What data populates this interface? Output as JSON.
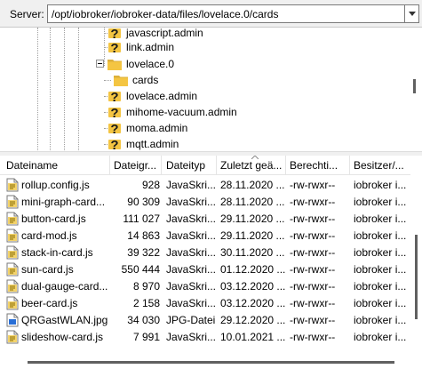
{
  "server": {
    "label": "Server:",
    "path": "/opt/iobroker/iobroker-data/files/lovelace.0/cards"
  },
  "tree": {
    "items": [
      {
        "label": "javascript.admin",
        "icon": "question-folder-icon"
      },
      {
        "label": "link.admin",
        "icon": "question-folder-icon"
      },
      {
        "label": "lovelace.0",
        "icon": "folder-icon",
        "expanded": true
      },
      {
        "label": "cards",
        "icon": "folder-icon",
        "selected": true
      },
      {
        "label": "lovelace.admin",
        "icon": "question-folder-icon"
      },
      {
        "label": "mihome-vacuum.admin",
        "icon": "question-folder-icon"
      },
      {
        "label": "moma.admin",
        "icon": "question-folder-icon"
      },
      {
        "label": "mqtt.admin",
        "icon": "question-folder-icon"
      }
    ]
  },
  "list": {
    "columns": [
      "Dateiname",
      "Dateigr...",
      "Dateityp",
      "Zuletzt geä...",
      "Berechti...",
      "Besitzer/..."
    ],
    "rows": [
      {
        "name": "rollup.config.js",
        "size": "928",
        "type": "JavaSkri...",
        "date": "28.11.2020 ...",
        "perm": "-rw-rwxr--",
        "owner": "iobroker i...",
        "icon": "js-file-icon"
      },
      {
        "name": "mini-graph-card...",
        "size": "90 309",
        "type": "JavaSkri...",
        "date": "28.11.2020 ...",
        "perm": "-rw-rwxr--",
        "owner": "iobroker i...",
        "icon": "js-file-icon"
      },
      {
        "name": "button-card.js",
        "size": "111 027",
        "type": "JavaSkri...",
        "date": "29.11.2020 ...",
        "perm": "-rw-rwxr--",
        "owner": "iobroker i...",
        "icon": "js-file-icon"
      },
      {
        "name": "card-mod.js",
        "size": "14 863",
        "type": "JavaSkri...",
        "date": "29.11.2020 ...",
        "perm": "-rw-rwxr--",
        "owner": "iobroker i...",
        "icon": "js-file-icon"
      },
      {
        "name": "stack-in-card.js",
        "size": "39 322",
        "type": "JavaSkri...",
        "date": "30.11.2020 ...",
        "perm": "-rw-rwxr--",
        "owner": "iobroker i...",
        "icon": "js-file-icon"
      },
      {
        "name": "sun-card.js",
        "size": "550 444",
        "type": "JavaSkri...",
        "date": "01.12.2020 ...",
        "perm": "-rw-rwxr--",
        "owner": "iobroker i...",
        "icon": "js-file-icon"
      },
      {
        "name": "dual-gauge-card...",
        "size": "8 970",
        "type": "JavaSkri...",
        "date": "03.12.2020 ...",
        "perm": "-rw-rwxr--",
        "owner": "iobroker i...",
        "icon": "js-file-icon"
      },
      {
        "name": "beer-card.js",
        "size": "2 158",
        "type": "JavaSkri...",
        "date": "03.12.2020 ...",
        "perm": "-rw-rwxr--",
        "owner": "iobroker i...",
        "icon": "js-file-icon"
      },
      {
        "name": "QRGastWLAN.jpg",
        "size": "34 030",
        "type": "JPG-Datei",
        "date": "29.12.2020 ...",
        "perm": "-rw-rwxr--",
        "owner": "iobroker i...",
        "icon": "image-file-icon"
      },
      {
        "name": "slideshow-card.js",
        "size": "7 991",
        "type": "JavaSkri...",
        "date": "10.01.2021 ...",
        "perm": "-rw-rwxr--",
        "owner": "iobroker i...",
        "icon": "js-file-icon"
      }
    ]
  },
  "colors": {
    "folder": "#f4c542",
    "question": "#e8a800",
    "scroll_thumb": "#606060"
  }
}
